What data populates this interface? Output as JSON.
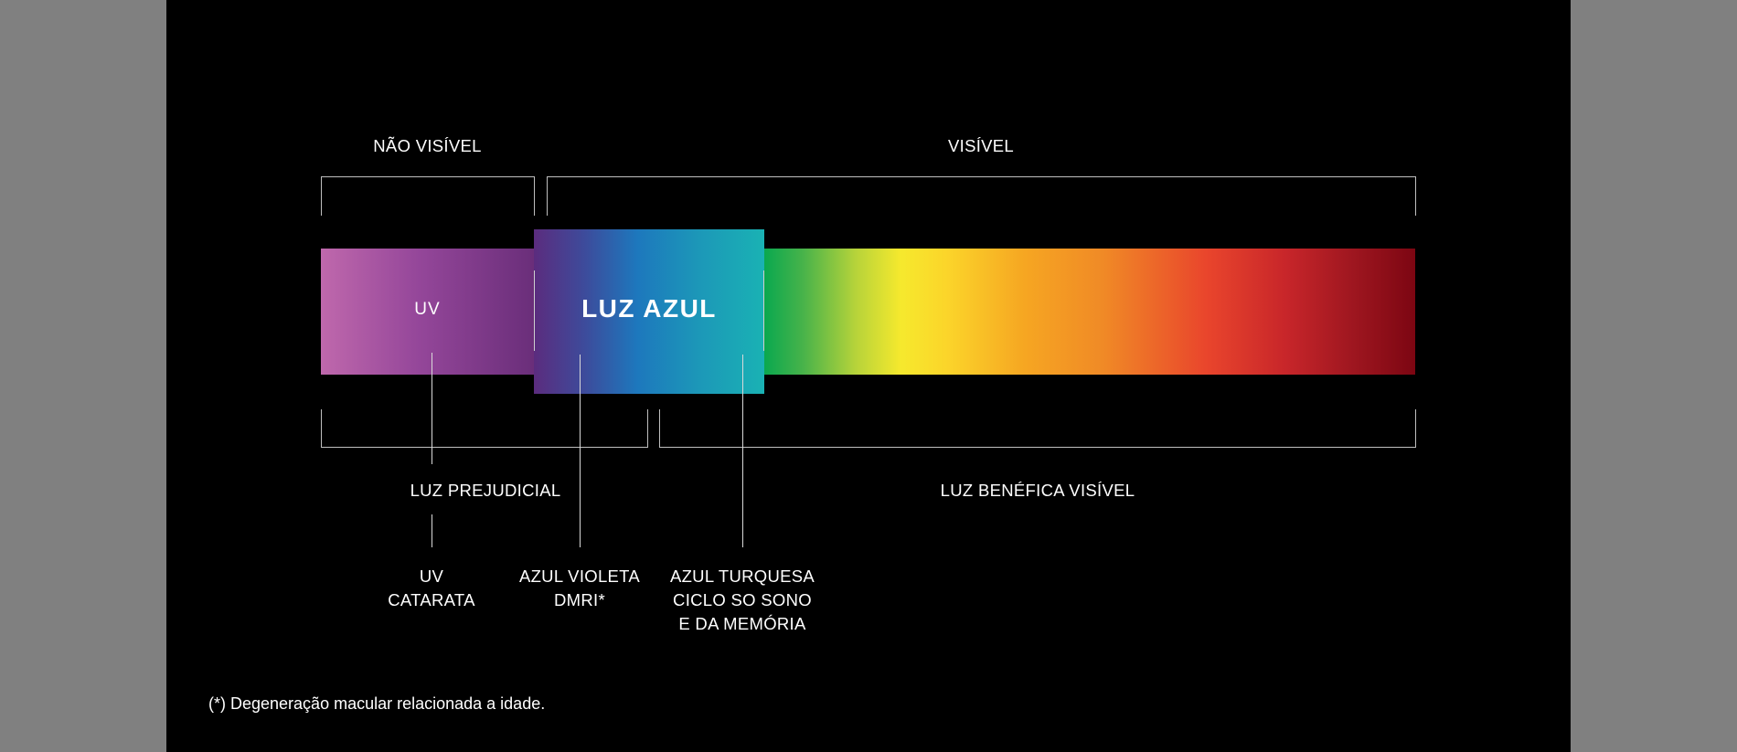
{
  "diagram": {
    "top_labels": {
      "not_visible": "NÃO VISÍVEL",
      "visible": "VISÍVEL"
    },
    "bar": {
      "uv_label": "UV",
      "blue_light_label": "LUZ AZUL"
    },
    "bottom_labels": {
      "harmful": "LUZ PREJUDICIAL",
      "beneficial": "LUZ BENÉFICA VISÍVEL"
    },
    "details": {
      "uv": {
        "line1": "UV",
        "line2": "CATARATA"
      },
      "violet": {
        "line1": "AZUL VIOLETA",
        "line2": "DMRI*"
      },
      "turquoise": {
        "line1": "AZUL TURQUESA",
        "line2": "CICLO SO SONO",
        "line3": "E DA MEMÓRIA"
      }
    },
    "footnote": "(*) Degeneração macular relacionada a idade."
  },
  "colors": {
    "side_background": "#808080",
    "diagram_background": "#000000",
    "uv": "#bf68ac",
    "blue": "#1d78bd",
    "turquoise": "#1ab2b4",
    "green": "#0aa84f",
    "yellow": "#f6e92d",
    "orange": "#f08a26",
    "red": "#e9452c",
    "dark_red": "#7c0612"
  }
}
